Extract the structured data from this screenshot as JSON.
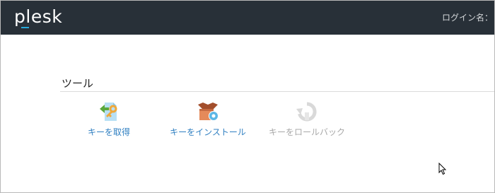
{
  "header": {
    "logo_text": "plesk",
    "login_label": "ログイン名：",
    "background_color": "#283038",
    "accent_color": "#28aadc"
  },
  "tools_section": {
    "title": "ツール",
    "items": [
      {
        "label": "キーを取得",
        "icon": "get-key-icon",
        "enabled": true
      },
      {
        "label": "キーをインストール",
        "icon": "install-key-icon",
        "enabled": true
      },
      {
        "label": "キーをロールバック",
        "icon": "rollback-key-icon",
        "enabled": false
      }
    ],
    "link_color": "#2f7fc1",
    "disabled_color": "#a8a8a8"
  }
}
